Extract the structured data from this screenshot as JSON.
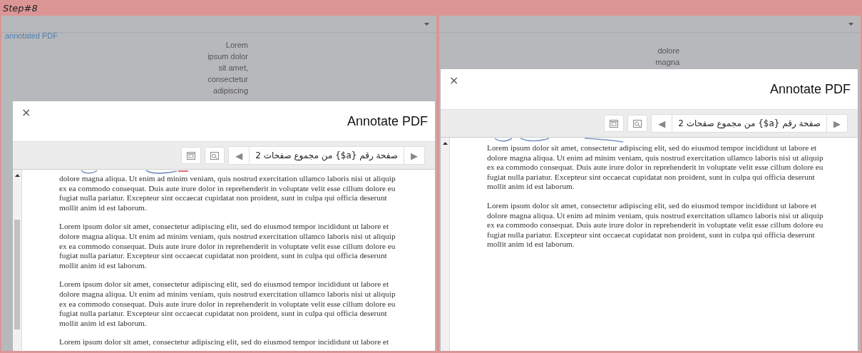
{
  "step_label": "Step#8",
  "panels": [
    {
      "background": {
        "link": "annotated PDF",
        "column_lines": [
          "Lorem",
          "ipsum dolor",
          "sit amet,",
          "consectetur",
          "adipiscing"
        ]
      },
      "dialog": {
        "close": "×",
        "title": "Annotate PDF",
        "pager": {
          "prev": "◀",
          "label": "صفحة رقم {a$} من مجموع صفحات 2",
          "next": "▶"
        },
        "paragraphs": [
          [
            "dolore magna aliqua. Ut enim ad minim veniam, quis nostrud exercitation ullamco laboris nisi ut aliquip",
            "ex ea commodo consequat. Duis aute irure dolor in reprehenderit in voluptate velit esse cillum dolore eu",
            "fugiat nulla pariatur. Excepteur sint occaecat cupidatat non proident, sunt in culpa qui officia deserunt",
            "mollit anim id est laborum."
          ],
          [
            "Lorem ipsum dolor sit amet, consectetur adipiscing elit, sed do eiusmod tempor incididunt ut labore et",
            "dolore magna aliqua. Ut enim ad minim veniam, quis nostrud exercitation ullamco laboris nisi ut aliquip",
            "ex ea commodo consequat. Duis aute irure dolor in reprehenderit in voluptate velit esse cillum dolore eu",
            "fugiat nulla pariatur. Excepteur sint occaecat cupidatat non proident, sunt in culpa qui officia deserunt",
            "mollit anim id est laborum."
          ],
          [
            "Lorem ipsum dolor sit amet, consectetur adipiscing elit, sed do eiusmod tempor incididunt ut labore et",
            "dolore magna aliqua. Ut enim ad minim veniam, quis nostrud exercitation ullamco laboris nisi ut aliquip",
            "ex ea commodo consequat. Duis aute irure dolor in reprehenderit in voluptate velit esse cillum dolore eu",
            "fugiat nulla pariatur. Excepteur sint occaecat cupidatat non proident, sunt in culpa qui officia deserunt",
            "mollit anim id est laborum."
          ],
          [
            "Lorem ipsum dolor sit amet, consectetur adipiscing elit, sed do eiusmod tempor incididunt ut labore et"
          ]
        ]
      }
    },
    {
      "background": {
        "column_lines": [
          "dolore",
          "magna"
        ]
      },
      "dialog": {
        "close": "×",
        "title": "Annotate PDF",
        "pager": {
          "prev": "◀",
          "label": "صفحة رقم {a$} من مجموع صفحات 2",
          "next": "▶"
        },
        "paragraphs": [
          [
            "Lorem ipsum dolor sit amet, consectetur adipiscing elit, sed do eiusmod tempor incididunt ut labore et",
            "dolore magna aliqua. Ut enim ad minim veniam, quis nostrud exercitation ullamco laboris nisi ut aliquip",
            "ex ea commodo consequat. Duis aute irure dolor in reprehenderit in voluptate velit esse cillum dolore eu",
            "fugiat nulla pariatur. Excepteur sint occaecat cupidatat non proident, sunt in culpa qui officia deserunt",
            "mollit anim id est laborum."
          ],
          [
            "Lorem ipsum dolor sit amet, consectetur adipiscing elit, sed do eiusmod tempor incididunt ut labore et",
            "dolore magna aliqua. Ut enim ad minim veniam, quis nostrud exercitation ullamco laboris nisi ut aliquip",
            "ex ea commodo consequat. Duis aute irure dolor in reprehenderit in voluptate velit esse cillum dolore eu",
            "fugiat nulla pariatur. Excepteur sint occaecat cupidatat non proident, sunt in culpa qui officia deserunt",
            "mollit anim id est laborum."
          ]
        ]
      }
    }
  ]
}
